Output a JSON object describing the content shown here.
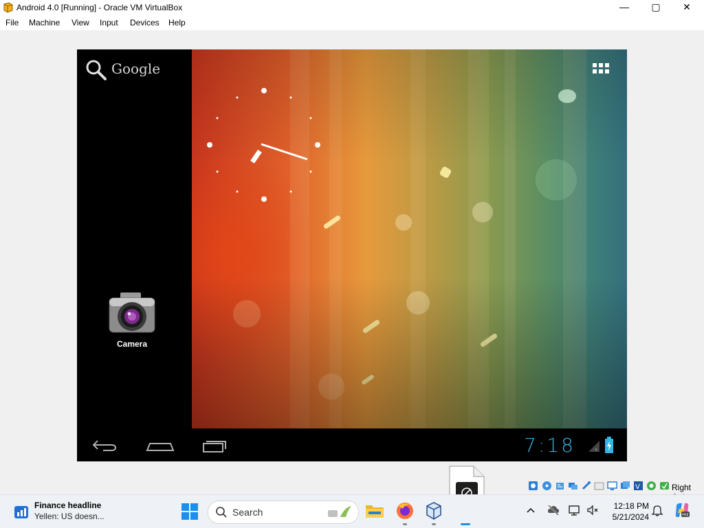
{
  "window": {
    "title": "Android 4.0 [Running] - Oracle VM VirtualBox",
    "controls": {
      "minimize": "—",
      "maximize": "▢",
      "close": "✕"
    }
  },
  "menu": [
    "File",
    "Machine",
    "View",
    "Input",
    "Devices",
    "Help"
  ],
  "guest": {
    "search_label": "Google",
    "app_label": "Camera",
    "time": "7:18",
    "accent_color": "#33b5e5"
  },
  "status_bar": {
    "host_key": "Right Ctrl",
    "icons": [
      "hard-disk-icon",
      "optical-drive-icon",
      "audio-icon",
      "network-icon",
      "usb-icon",
      "shared-folders-icon",
      "display-icon",
      "recording-icon",
      "virtualization-icon",
      "mouse-integration-icon",
      "keyboard-icon"
    ]
  },
  "taskbar": {
    "news_title": "Finance headline",
    "news_subtitle": "Yellen: US doesn...",
    "search_label": "Search",
    "clock_time": "12:18 PM",
    "clock_date": "5/21/2024"
  }
}
